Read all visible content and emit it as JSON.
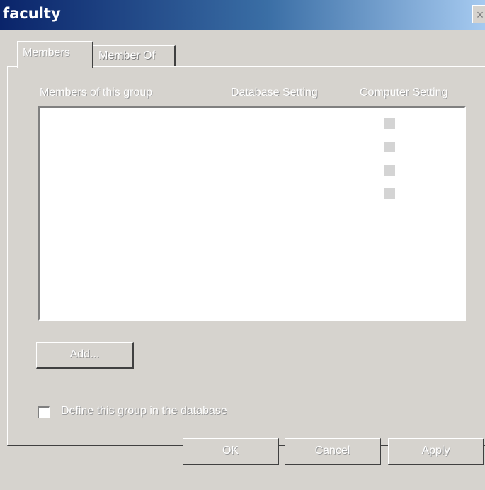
{
  "window": {
    "title": "faculty",
    "close_glyph": "×"
  },
  "tabs": [
    {
      "label": "Members",
      "active": true
    },
    {
      "label": "Member Of",
      "active": false
    }
  ],
  "list": {
    "columns": [
      "Members of this group",
      "Database Setting",
      "Computer Setting"
    ],
    "rows": []
  },
  "buttons": {
    "add": "Add...",
    "ok": "OK",
    "cancel": "Cancel",
    "apply": "Apply"
  },
  "checkbox": {
    "label": "Define this group in the database",
    "checked": false
  },
  "colors": {
    "title_bar_start": "#0a246a",
    "title_bar_end": "#a6caf0",
    "dialog_face": "#d6d3ce"
  }
}
